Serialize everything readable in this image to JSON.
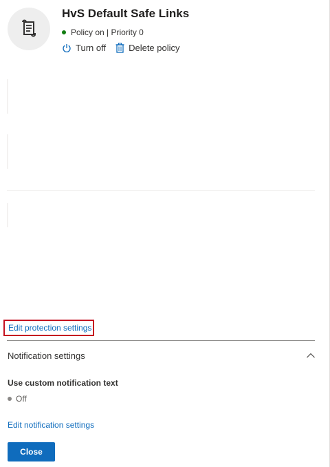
{
  "header": {
    "title": "HvS Default Safe Links",
    "status_text": "Policy on | Priority 0",
    "status_color": "#107c10",
    "avatar_icon": "scroll-icon"
  },
  "actions": {
    "turn_off": {
      "label": "Turn off",
      "icon": "power-icon"
    },
    "delete": {
      "label": "Delete policy",
      "icon": "trash-icon"
    }
  },
  "protection": {
    "edit_link": "Edit protection settings",
    "highlight_color": "#c50f1f"
  },
  "notification": {
    "section_title": "Notification settings",
    "expand_icon": "chevron-up-icon",
    "custom_text_label": "Use custom notification text",
    "custom_text_value": "Off",
    "edit_link": "Edit notification settings"
  },
  "footer": {
    "close_label": "Close"
  },
  "colors": {
    "accent": "#0f6cbd"
  }
}
